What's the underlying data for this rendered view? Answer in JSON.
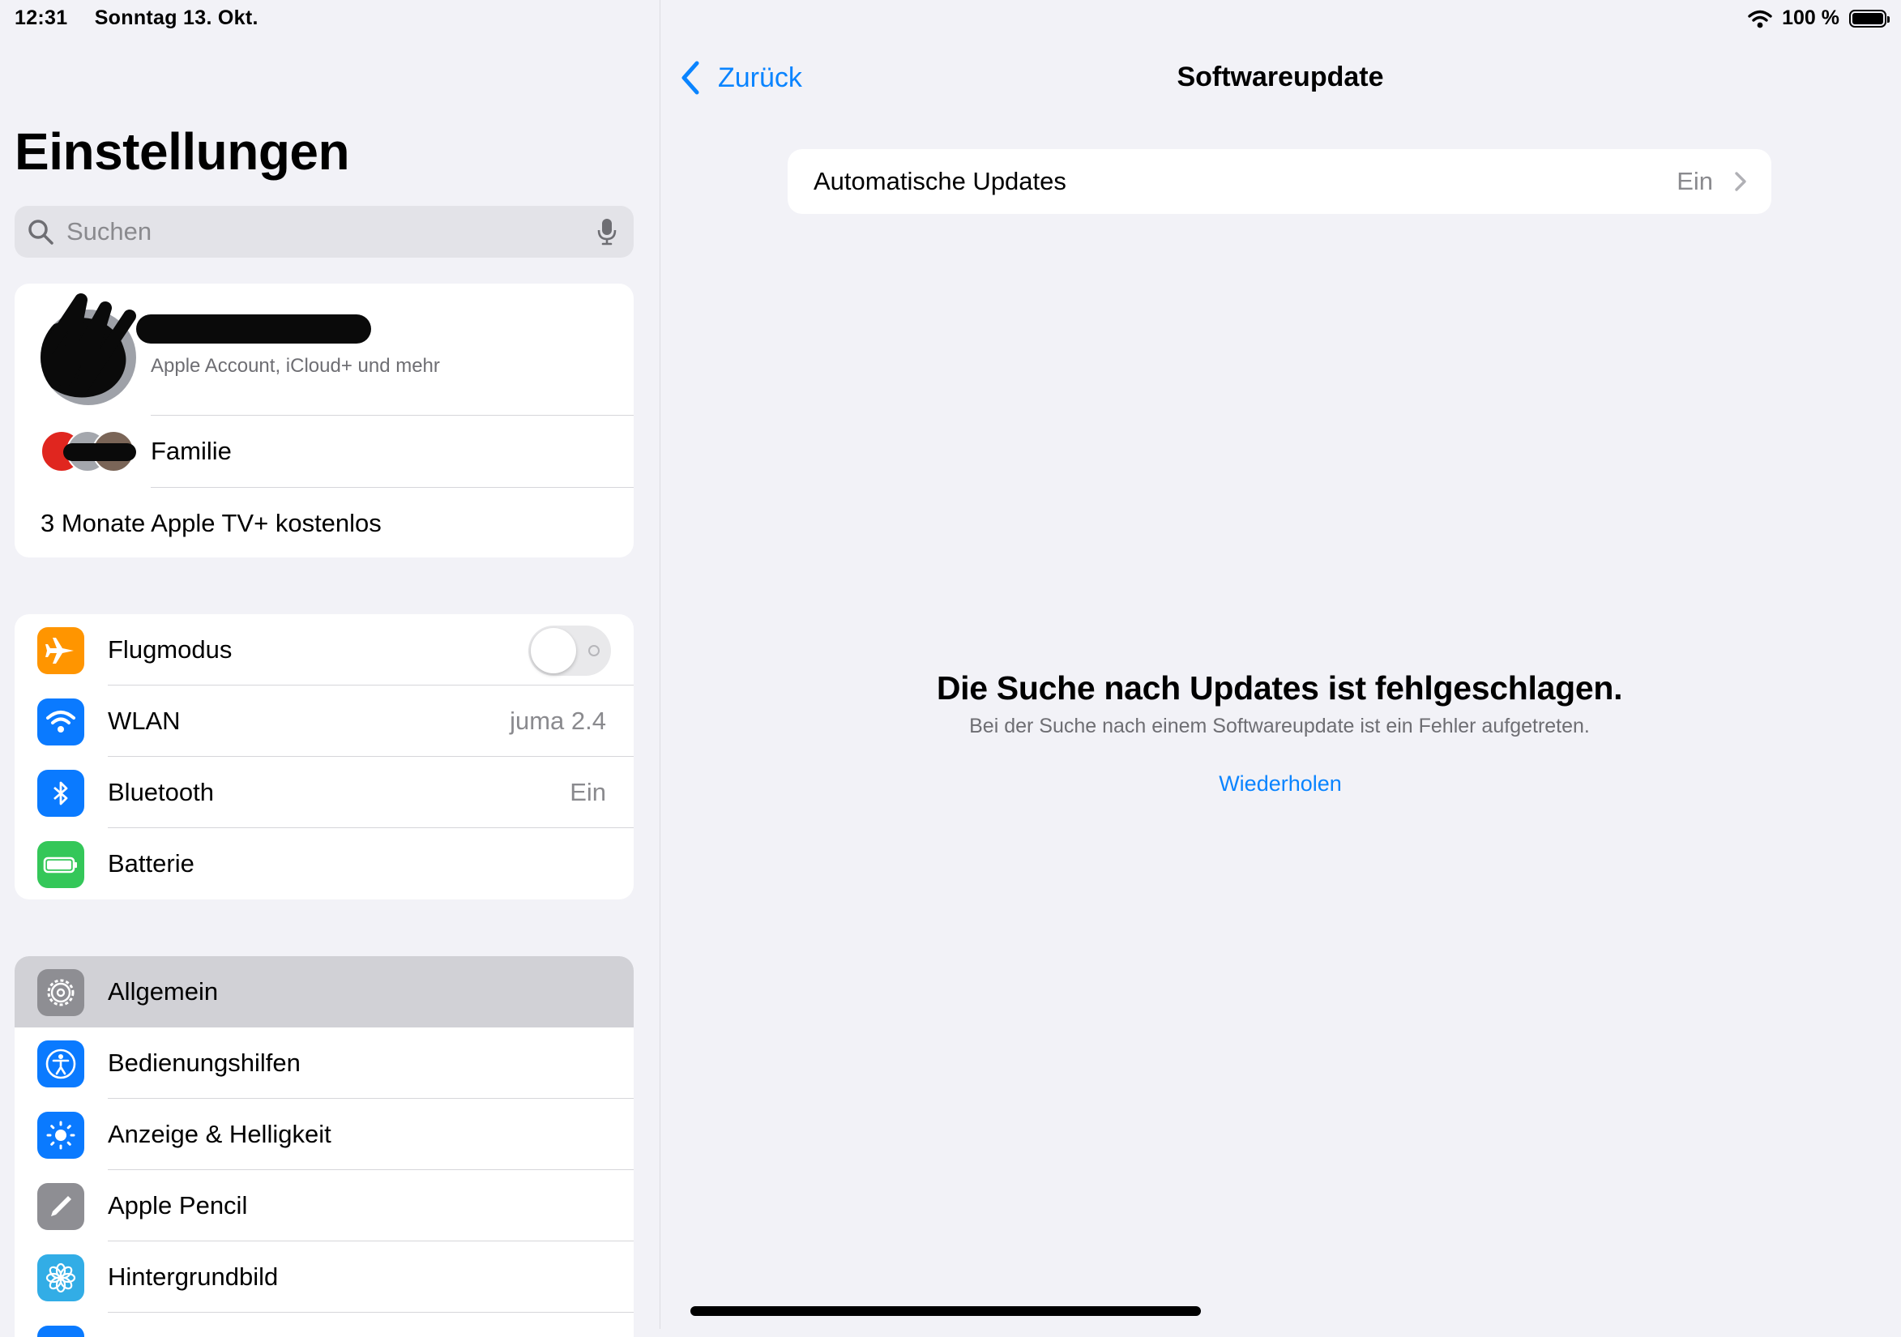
{
  "status_bar": {
    "time": "12:31",
    "date": "Sonntag 13. Okt.",
    "battery": "100 %",
    "battery_level": 1.0
  },
  "sidebar": {
    "title": "Einstellungen",
    "search": {
      "placeholder": "Suchen",
      "value": ""
    },
    "profile": {
      "subtitle": "Apple Account, iCloud+ und mehr"
    },
    "family": {
      "label": "Familie"
    },
    "promo": {
      "label": "3 Monate Apple TV+ kostenlos"
    },
    "connectivity": [
      {
        "label": "Flugmodus",
        "icon": "airplane-icon",
        "color": "#ff9500",
        "toggle": false
      },
      {
        "label": "WLAN",
        "icon": "wifi-icon",
        "color": "#0a7aff",
        "value": "juma 2.4"
      },
      {
        "label": "Bluetooth",
        "icon": "bluetooth-icon",
        "color": "#0a7aff",
        "value": "Ein"
      },
      {
        "label": "Batterie",
        "icon": "battery-icon",
        "color": "#34c759"
      }
    ],
    "general": [
      {
        "label": "Allgemein",
        "icon": "gear-icon",
        "color": "#8e8e93",
        "selected": true
      },
      {
        "label": "Bedienungshilfen",
        "icon": "accessibility-icon",
        "color": "#0a7aff"
      },
      {
        "label": "Anzeige & Helligkeit",
        "icon": "brightness-icon",
        "color": "#0a7aff"
      },
      {
        "label": "Apple Pencil",
        "icon": "pencil-icon",
        "color": "#8e8e93"
      },
      {
        "label": "Hintergrundbild",
        "icon": "wallpaper-flower-icon",
        "color": "#32ade6"
      }
    ]
  },
  "detail": {
    "back_label": "Zurück",
    "title": "Softwareupdate",
    "auto_updates": {
      "label": "Automatische Updates",
      "value": "Ein"
    },
    "error": {
      "title": "Die Suche nach Updates ist fehlgeschlagen.",
      "subtitle": "Bei der Suche nach einem Softwareupdate ist ein Fehler aufgetreten.",
      "retry_label": "Wiederholen"
    }
  },
  "colors": {
    "accent": "#0a84ff",
    "background": "#f2f2f7"
  }
}
